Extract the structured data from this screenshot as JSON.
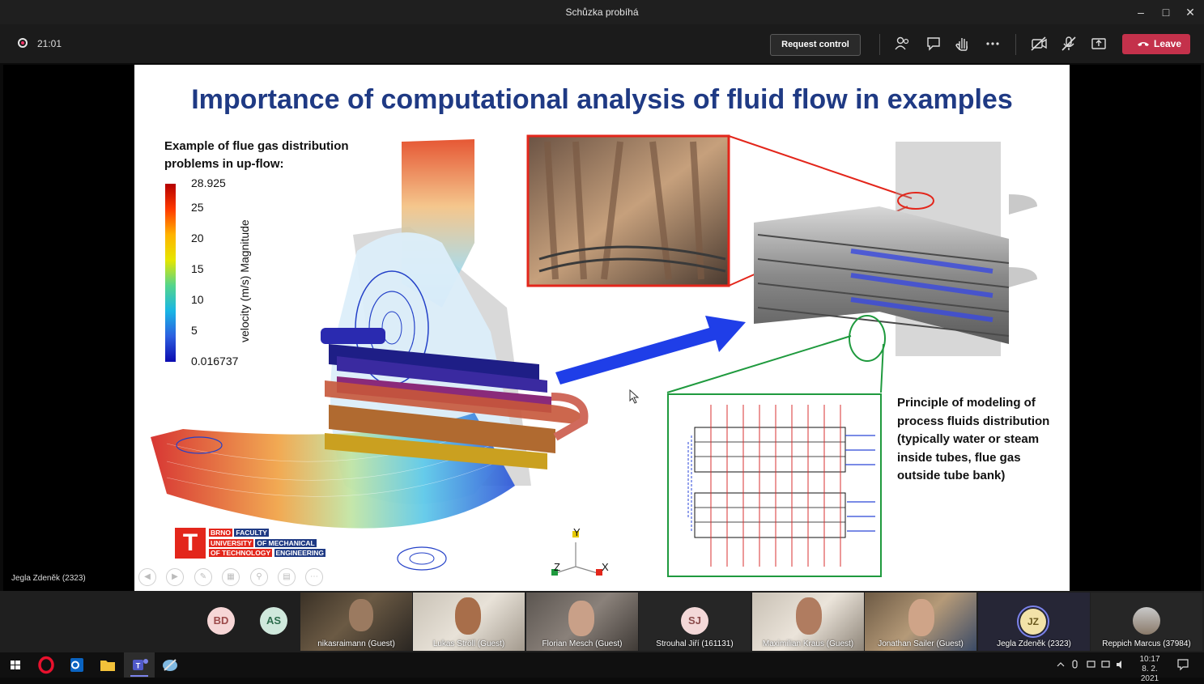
{
  "window": {
    "title": "Schůzka probíhá",
    "controls": [
      "minimize-icon",
      "maximize-icon",
      "close-icon"
    ]
  },
  "toolbar": {
    "recording_time": "21:01",
    "request_control": "Request control",
    "icons": [
      "participants-icon",
      "chat-icon",
      "raise-hand-icon",
      "more-icon",
      "camera-off-icon",
      "mic-off-icon",
      "share-screen-icon"
    ],
    "leave_label": "Leave",
    "leave_color": "#c4314b"
  },
  "presenter_label": "Jegla Zdeněk (2323)",
  "slide": {
    "title": "Importance of computational analysis of fluid flow in examples",
    "title_color": "#1f3a84",
    "subtitle_line1": "Example of flue gas distribution",
    "subtitle_line2": "problems in up-flow:",
    "legend": {
      "max": "28.925",
      "t25": "25",
      "t20": "20",
      "t15": "15",
      "t10": "10",
      "t5": "5",
      "min": "0.016737",
      "label": "velocity (m/s) Magnitude"
    },
    "principle_lines": [
      "Principle of modeling of",
      "process fluids distribution",
      "(typically water or steam",
      "inside tubes, flue gas",
      "outside tube bank)"
    ],
    "logo": {
      "row1a": "BRNO",
      "row1b": "FACULTY",
      "row2a": "UNIVERSITY",
      "row2b": "OF MECHANICAL",
      "row3a": "OF TECHNOLOGY",
      "row3b": "ENGINEERING"
    },
    "axes": {
      "y": "Y",
      "z": "Z",
      "x": "X"
    },
    "accent_red": "#e3261b",
    "accent_green": "#1f9a3e",
    "accent_blue": "#1f3ee8"
  },
  "participants": [
    {
      "kind": "avatar",
      "initials": "BD",
      "bg": "#f6d6d6",
      "fg": "#9c4a4a"
    },
    {
      "kind": "avatar",
      "initials": "AS",
      "bg": "#cfe8dc",
      "fg": "#2c6b4c"
    },
    {
      "kind": "video",
      "name": "nikasraimann (Guest)"
    },
    {
      "kind": "video",
      "name": "Lukas Ströll (Guest)"
    },
    {
      "kind": "video",
      "name": "Florian Mesch (Guest)"
    },
    {
      "kind": "avatar",
      "initials": "SJ",
      "name": "Strouhal Jiří (161131)"
    },
    {
      "kind": "video",
      "name": "Maximilian Kraus (Guest)"
    },
    {
      "kind": "video",
      "name": "Jonathan Sailer (Guest)"
    },
    {
      "kind": "avatar",
      "initials": "JZ",
      "name": "Jegla Zdeněk (2323)"
    },
    {
      "kind": "avatar",
      "initials": "",
      "name": "Reppich Marcus (37984)"
    }
  ],
  "taskbar": {
    "time": "10:17",
    "date": "8. 2. 2021",
    "apps": [
      "windows-start-icon",
      "opera-icon",
      "outlook-icon",
      "file-explorer-icon",
      "teams-icon",
      "paint-icon"
    ]
  }
}
